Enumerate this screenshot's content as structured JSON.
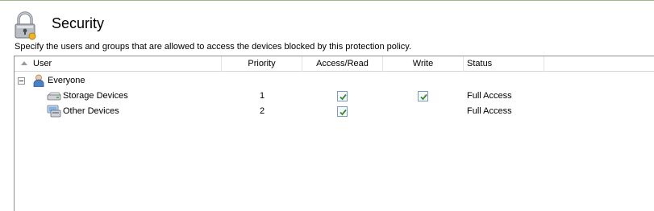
{
  "header": {
    "title": "Security",
    "description": "Specify the users and groups that are allowed to access the devices blocked by this protection policy."
  },
  "table": {
    "columns": [
      "User",
      "Priority",
      "Access/Read",
      "Write",
      "Status"
    ],
    "group": {
      "label": "Everyone",
      "expanded": true
    },
    "rows": [
      {
        "name": "Storage Devices",
        "priority": "1",
        "access_read": true,
        "write": true,
        "status": "Full Access"
      },
      {
        "name": "Other Devices",
        "priority": "2",
        "access_read": true,
        "write": false,
        "status": "Full Access"
      }
    ]
  },
  "colors": {
    "check": "#3a8a2e",
    "checkbox_border": "#7a9cbb"
  }
}
